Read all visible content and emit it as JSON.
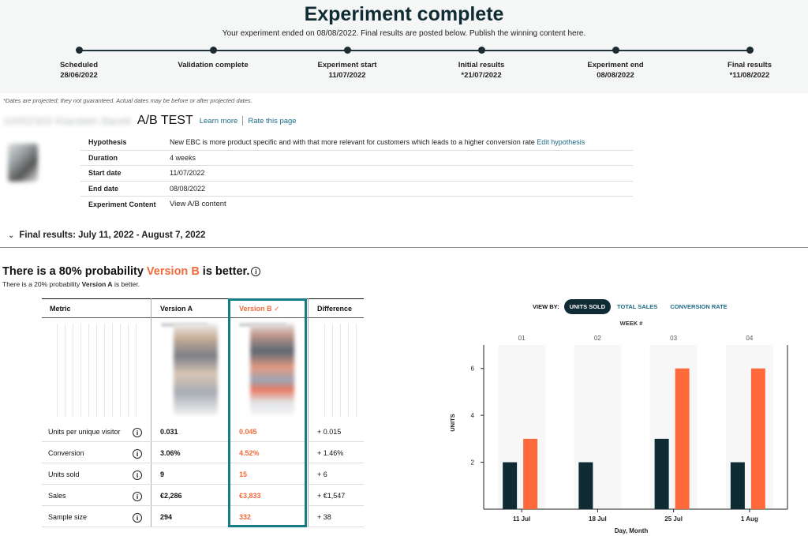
{
  "header": {
    "title": "Experiment complete",
    "subtitle": "Your experiment ended on 08/08/2022. Final results are posted below. Publish the winning content here."
  },
  "timeline": [
    {
      "label": "Scheduled",
      "date": "28/06/2022"
    },
    {
      "label": "Validation complete",
      "date": ""
    },
    {
      "label": "Experiment start",
      "date": "11/07/2022"
    },
    {
      "label": "Initial results",
      "date": "*21/07/2022"
    },
    {
      "label": "Experiment end",
      "date": "08/08/2022"
    },
    {
      "label": "Final results",
      "date": "*11/08/2022"
    }
  ],
  "dates_note": "*Dates are projected; they not guaranteed. Actual dates may be before or after projected dates.",
  "product": {
    "name_blurred": "10052303 Klarstein Barett",
    "test_title": "A/B TEST",
    "learn_more": "Learn more",
    "rate_page": "Rate this page"
  },
  "info": {
    "hypothesis_label": "Hypothesis",
    "hypothesis_value": "New EBC is more product specific and with that more relevant for customers which leads to a higher conversion rate",
    "edit_hypothesis": "Edit hypothesis",
    "duration_label": "Duration",
    "duration_value": "4 weeks",
    "start_label": "Start date",
    "start_value": "11/07/2022",
    "end_label": "End date",
    "end_value": "08/08/2022",
    "content_label": "Experiment Content",
    "content_link": "View A/B content"
  },
  "final_results": {
    "header": "Final results: July 11, 2022 - August 7, 2022",
    "prob_prefix": "There is a 80% probability",
    "prob_version": "Version B",
    "prob_suffix": "is better.",
    "sub_prefix": "There is a 20% probability",
    "sub_version": "Version A",
    "sub_suffix": "is better."
  },
  "metrics": {
    "headers": {
      "metric": "Metric",
      "a": "Version A",
      "b": "Version B",
      "diff": "Difference",
      "check": "✓"
    },
    "rows": [
      {
        "metric": "Units per unique visitor",
        "a": "0.031",
        "b": "0.045",
        "diff": "+ 0.015"
      },
      {
        "metric": "Conversion",
        "a": "3.06%",
        "b": "4.52%",
        "diff": "+ 1.46%"
      },
      {
        "metric": "Units sold",
        "a": "9",
        "b": "15",
        "diff": "+ 6"
      },
      {
        "metric": "Sales",
        "a": "€2,286",
        "b": "€3,833",
        "diff": "+ €1,547"
      },
      {
        "metric": "Sample size",
        "a": "294",
        "b": "332",
        "diff": "+ 38"
      }
    ]
  },
  "chart_view": {
    "view_by": "VIEW BY:",
    "tabs": [
      "UNITS SOLD",
      "TOTAL SALES",
      "CONVERSION RATE"
    ],
    "selected": "UNITS SOLD"
  },
  "chart_data": {
    "type": "bar",
    "categories": [
      "11 Jul",
      "18 Jul",
      "25 Jul",
      "1 Aug"
    ],
    "top_axis_title": "WEEK #",
    "top_labels": [
      "01",
      "02",
      "03",
      "04"
    ],
    "series": [
      {
        "color": "#0f2b33",
        "values": [
          2,
          2,
          3,
          2
        ]
      },
      {
        "color": "#ff6a3d",
        "values": [
          3,
          0,
          6,
          6
        ]
      }
    ],
    "xlabel": "Day, Month",
    "ylabel": "UNITS",
    "yticks": [
      2,
      4,
      6
    ],
    "ylim": [
      0,
      7
    ],
    "grid": false
  },
  "colors": {
    "accent": "#f26a3a",
    "dark": "#0f2b33",
    "link": "#1b6a86",
    "highlight_box": "#147d86"
  }
}
